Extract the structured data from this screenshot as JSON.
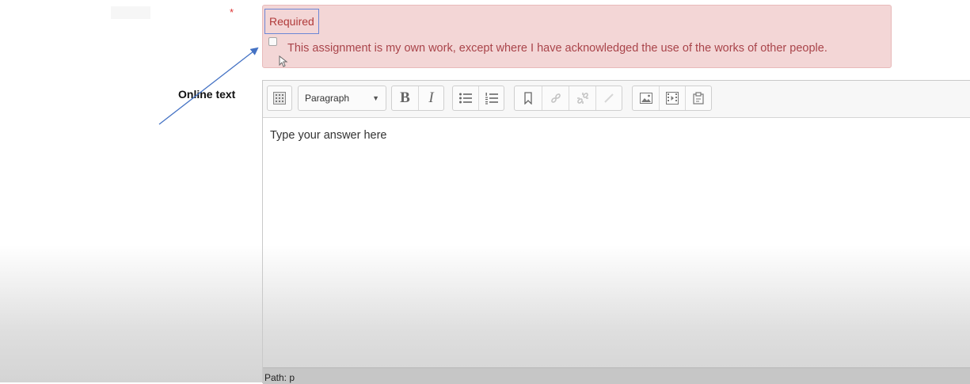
{
  "form": {
    "required_marker": "*",
    "required_message": "Required",
    "acknowledgement_label": "This assignment is my own work, except where I have acknowledged the use of the works of other people.",
    "acknowledgement_checked": false
  },
  "online_text": {
    "label": "Online text",
    "toolbar": {
      "block_format": "Paragraph",
      "buttons": [
        {
          "name": "toggle-toolbar",
          "icon": "toolbar-grid-icon"
        },
        {
          "name": "bold",
          "icon": "bold-icon"
        },
        {
          "name": "italic",
          "icon": "italic-icon"
        },
        {
          "name": "unordered-list",
          "icon": "bullet-list-icon"
        },
        {
          "name": "ordered-list",
          "icon": "numbered-list-icon"
        },
        {
          "name": "anchor",
          "icon": "bookmark-icon"
        },
        {
          "name": "link",
          "icon": "link-icon"
        },
        {
          "name": "unlink",
          "icon": "unlink-icon"
        },
        {
          "name": "emoticon",
          "icon": "emoticon-icon"
        },
        {
          "name": "insert-image",
          "icon": "image-icon"
        },
        {
          "name": "insert-media",
          "icon": "media-icon"
        },
        {
          "name": "manage-files",
          "icon": "files-icon"
        }
      ]
    },
    "content_placeholder": "Type your answer here",
    "status_path": "Path: p"
  },
  "annotation": {
    "color": "#4472c4",
    "icon": "arrow-annotation"
  },
  "colors": {
    "error_background": "#f3d6d6",
    "error_text": "#a9444a",
    "required_star": "#dd3333",
    "focus_outline": "#6b86d6"
  }
}
